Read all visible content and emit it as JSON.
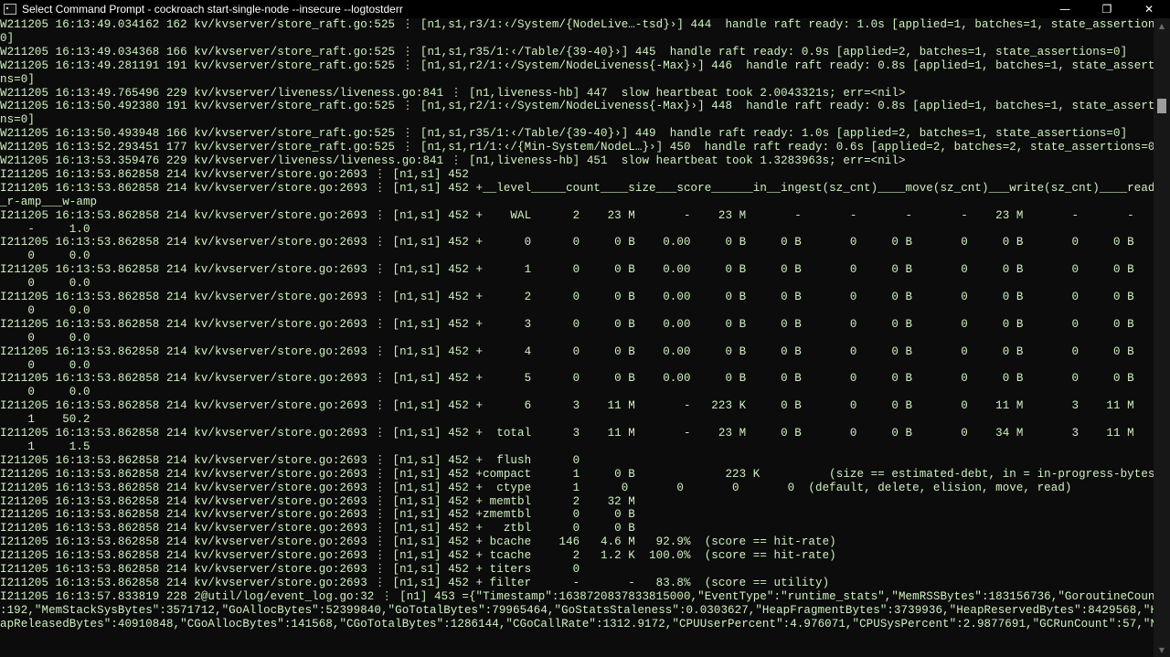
{
  "window": {
    "title": "Select Command Prompt - cockroach  start-single-node --insecure --logtostderr",
    "minimize_glyph": "—",
    "maximize_glyph": "❐",
    "close_glyph": "✕"
  },
  "console": {
    "text_color": "#d0f2c0",
    "background": "#0c0c0c",
    "lines": [
      "W211205 16:13:49.034162 162 kv/kvserver/store_raft.go:525 ⋮ [n1,s1,r3/1:‹/System/{NodeLive…-tsd}›] 444  handle raft ready: 1.0s [applied=1, batches=1, state_assertions=",
      "0]",
      "W211205 16:13:49.034368 166 kv/kvserver/store_raft.go:525 ⋮ [n1,s1,r35/1:‹/Table/{39-40}›] 445  handle raft ready: 0.9s [applied=2, batches=1, state_assertions=0]",
      "W211205 16:13:49.281191 191 kv/kvserver/store_raft.go:525 ⋮ [n1,s1,r2/1:‹/System/NodeLiveness{-Max}›] 446  handle raft ready: 0.8s [applied=1, batches=1, state_assertio",
      "ns=0]",
      "W211205 16:13:49.765496 229 kv/kvserver/liveness/liveness.go:841 ⋮ [n1,liveness-hb] 447  slow heartbeat took 2.0043321s; err=<nil>",
      "W211205 16:13:50.492380 191 kv/kvserver/store_raft.go:525 ⋮ [n1,s1,r2/1:‹/System/NodeLiveness{-Max}›] 448  handle raft ready: 0.8s [applied=1, batches=1, state_assertio",
      "ns=0]",
      "W211205 16:13:50.493948 166 kv/kvserver/store_raft.go:525 ⋮ [n1,s1,r35/1:‹/Table/{39-40}›] 449  handle raft ready: 1.0s [applied=2, batches=1, state_assertions=0]",
      "W211205 16:13:52.293451 177 kv/kvserver/store_raft.go:525 ⋮ [n1,s1,r1/1:‹/{Min-System/NodeL…}›] 450  handle raft ready: 0.6s [applied=2, batches=2, state_assertions=0]",
      "W211205 16:13:53.359476 229 kv/kvserver/liveness/liveness.go:841 ⋮ [n1,liveness-hb] 451  slow heartbeat took 1.3283963s; err=<nil>",
      "I211205 16:13:53.862858 214 kv/kvserver/store.go:2693 ⋮ [n1,s1] 452",
      "I211205 16:13:53.862858 214 kv/kvserver/store.go:2693 ⋮ [n1,s1] 452 +__level_____count____size___score______in__ingest(sz_cnt)____move(sz_cnt)___write(sz_cnt)____read__",
      "_r-amp___w-amp",
      "I211205 16:13:53.862858 214 kv/kvserver/store.go:2693 ⋮ [n1,s1] 452 +    WAL      2    23 M       -    23 M       -       -       -       -    23 M       -       -",
      "    -     1.0",
      "I211205 16:13:53.862858 214 kv/kvserver/store.go:2693 ⋮ [n1,s1] 452 +      0      0     0 B    0.00     0 B     0 B       0     0 B       0     0 B       0     0 B",
      "    0     0.0",
      "I211205 16:13:53.862858 214 kv/kvserver/store.go:2693 ⋮ [n1,s1] 452 +      1      0     0 B    0.00     0 B     0 B       0     0 B       0     0 B       0     0 B",
      "    0     0.0",
      "I211205 16:13:53.862858 214 kv/kvserver/store.go:2693 ⋮ [n1,s1] 452 +      2      0     0 B    0.00     0 B     0 B       0     0 B       0     0 B       0     0 B",
      "    0     0.0",
      "I211205 16:13:53.862858 214 kv/kvserver/store.go:2693 ⋮ [n1,s1] 452 +      3      0     0 B    0.00     0 B     0 B       0     0 B       0     0 B       0     0 B",
      "    0     0.0",
      "I211205 16:13:53.862858 214 kv/kvserver/store.go:2693 ⋮ [n1,s1] 452 +      4      0     0 B    0.00     0 B     0 B       0     0 B       0     0 B       0     0 B",
      "    0     0.0",
      "I211205 16:13:53.862858 214 kv/kvserver/store.go:2693 ⋮ [n1,s1] 452 +      5      0     0 B    0.00     0 B     0 B       0     0 B       0     0 B       0     0 B",
      "    0     0.0",
      "I211205 16:13:53.862858 214 kv/kvserver/store.go:2693 ⋮ [n1,s1] 452 +      6      3    11 M       -   223 K     0 B       0     0 B       0    11 M       3    11 M",
      "    1    50.2",
      "I211205 16:13:53.862858 214 kv/kvserver/store.go:2693 ⋮ [n1,s1] 452 +  total      3    11 M       -    23 M     0 B       0     0 B       0    34 M       3    11 M",
      "    1     1.5",
      "I211205 16:13:53.862858 214 kv/kvserver/store.go:2693 ⋮ [n1,s1] 452 +  flush      0",
      "I211205 16:13:53.862858 214 kv/kvserver/store.go:2693 ⋮ [n1,s1] 452 +compact      1     0 B             223 K          (size == estimated-debt, in = in-progress-bytes)",
      "I211205 16:13:53.862858 214 kv/kvserver/store.go:2693 ⋮ [n1,s1] 452 +  ctype      1      0       0       0       0  (default, delete, elision, move, read)",
      "I211205 16:13:53.862858 214 kv/kvserver/store.go:2693 ⋮ [n1,s1] 452 + memtbl      2    32 M",
      "I211205 16:13:53.862858 214 kv/kvserver/store.go:2693 ⋮ [n1,s1] 452 +zmemtbl      0     0 B",
      "I211205 16:13:53.862858 214 kv/kvserver/store.go:2693 ⋮ [n1,s1] 452 +   ztbl      0     0 B",
      "I211205 16:13:53.862858 214 kv/kvserver/store.go:2693 ⋮ [n1,s1] 452 + bcache    146   4.6 M   92.9%  (score == hit-rate)",
      "I211205 16:13:53.862858 214 kv/kvserver/store.go:2693 ⋮ [n1,s1] 452 + tcache      2   1.2 K  100.0%  (score == hit-rate)",
      "I211205 16:13:53.862858 214 kv/kvserver/store.go:2693 ⋮ [n1,s1] 452 + titers      0",
      "I211205 16:13:53.862858 214 kv/kvserver/store.go:2693 ⋮ [n1,s1] 452 + filter      -       -   83.8%  (score == utility)",
      "I211205 16:13:57.833819 228 2@util/log/event_log.go:32 ⋮ [n1] 453 ={\"Timestamp\":1638720837833815000,\"EventType\":\"runtime_stats\",\"MemRSSBytes\":183156736,\"GoroutineCount\"",
      ":192,\"MemStackSysBytes\":3571712,\"GoAllocBytes\":52399840,\"GoTotalBytes\":79965464,\"GoStatsStaleness\":0.0303627,\"HeapFragmentBytes\":3739936,\"HeapReservedBytes\":8429568,\"He",
      "apReleasedBytes\":40910848,\"CGoAllocBytes\":141568,\"CGoTotalBytes\":1286144,\"CGoCallRate\":1312.9172,\"CPUUserPercent\":4.976071,\"CPUSysPercent\":2.9877691,\"GCRunCount\":57,\"Ne"
    ]
  },
  "scrollbar": {
    "up_glyph": "▲",
    "down_glyph": "▼"
  }
}
